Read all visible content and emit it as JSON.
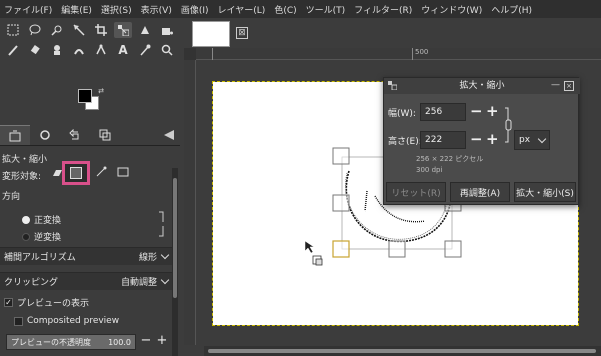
{
  "menubar": [
    "ファイル(F)",
    "編集(E)",
    "選択(S)",
    "表示(V)",
    "画像(I)",
    "レイヤー(L)",
    "色(C)",
    "ツール(T)",
    "フィルター(R)",
    "ウィンドウ(W)",
    "ヘルプ(H)"
  ],
  "tool_options": {
    "title": "拡大・縮小",
    "transform_label": "変形対象:",
    "direction_label": "方向",
    "direction_forward": "正変換",
    "direction_backward": "逆変換",
    "interpolation_label": "補間アルゴリズム",
    "interpolation_value": "線形",
    "clipping_label": "クリッピング",
    "clipping_value": "自動調整",
    "show_preview_label": "プレビューの表示",
    "show_preview_checked": true,
    "composited_preview_label": "Composited preview",
    "composited_preview_checked": false,
    "preview_opacity_label": "プレビューの不透明度",
    "preview_opacity_value": "100.0",
    "preview_opacity_fraction": 1.0
  },
  "rulers": {
    "top_label": "500"
  },
  "image_tab": {
    "close_symbol": "⊠"
  },
  "scale_dialog": {
    "title": "拡大・縮小",
    "width_label": "幅(W):",
    "width_value": "256",
    "height_label": "高さ(E):",
    "height_value": "222",
    "unit": "px",
    "size_info": "256 × 222 ピクセル",
    "dpi_info": "300 dpi",
    "reset_label": "リセット(R)",
    "readjust_label": "再調整(A)",
    "scale_label": "拡大・縮小(S)",
    "plus": "+",
    "minus": "−"
  },
  "colors": {
    "accent_highlight": "#d8508a",
    "selection_outline": "#ccbd00"
  }
}
